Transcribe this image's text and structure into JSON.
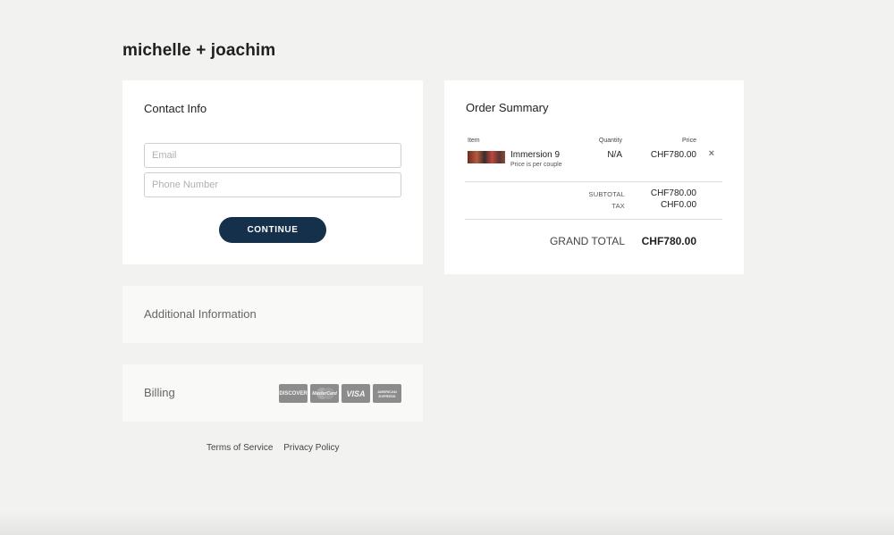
{
  "brand": {
    "title": "michelle + joachim"
  },
  "contact": {
    "title": "Contact Info",
    "email_placeholder": "Email",
    "phone_placeholder": "Phone Number",
    "continue_label": "CONTINUE"
  },
  "additional": {
    "title": "Additional Information"
  },
  "billing": {
    "title": "Billing",
    "cards": [
      {
        "label": "DISCOVER",
        "icon": "discover-card-icon"
      },
      {
        "label": "MasterCard",
        "icon": "mastercard-card-icon"
      },
      {
        "label": "VISA",
        "icon": "visa-card-icon"
      },
      {
        "label": "AMERICAN EXPRESS",
        "icon": "amex-card-icon"
      }
    ]
  },
  "footer": {
    "terms": "Terms of Service",
    "privacy": "Privacy Policy"
  },
  "summary": {
    "title": "Order Summary",
    "headers": {
      "item": "Item",
      "quantity": "Quantity",
      "price": "Price"
    },
    "item": {
      "name": "Immersion 9",
      "note": "Price is per couple",
      "quantity": "N/A",
      "price": "CHF780.00",
      "remove_icon": "×"
    },
    "subtotal_label": "SUBTOTAL",
    "subtotal_value": "CHF780.00",
    "tax_label": "TAX",
    "tax_value": "CHF0.00",
    "grand_total_label": "GRAND TOTAL",
    "grand_total_value": "CHF780.00"
  },
  "colors": {
    "accent": "#15304a",
    "background": "#f2f2f0"
  }
}
